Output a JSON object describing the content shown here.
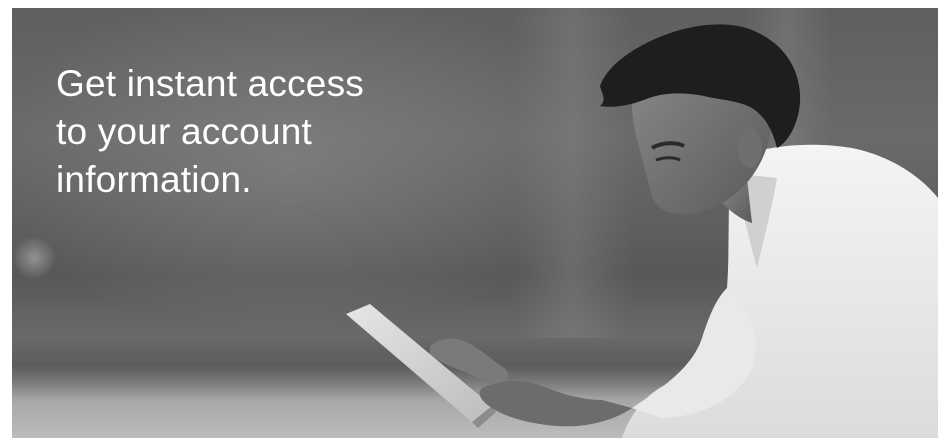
{
  "hero": {
    "headline_lines": [
      "Get instant access",
      "to your account",
      "information."
    ],
    "image_description_icon": "person-with-tablet-photo"
  },
  "colors": {
    "headline_text": "#ffffff",
    "background_dark": "#5f5f5f",
    "shirt": "#f2f2f2"
  }
}
